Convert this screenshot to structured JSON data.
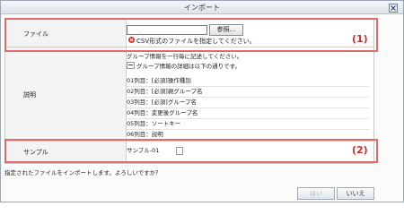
{
  "dialog": {
    "title": "インポート",
    "prompt": "指定されたファイルをインポートします。よろしいですか？",
    "yes_label": "はい",
    "no_label": "いいえ"
  },
  "form": {
    "file_label": "ファイル",
    "file_value": "",
    "browse_label": "参照...",
    "error_text": "CSV形式のファイルを指定してください。",
    "desc_label": "説明",
    "desc_line1": "グループ情報を一行毎に記述してください。",
    "desc_line2": "グループ情報の詳細は以下の通りです。",
    "columns": [
      "01列目：[必須]操作種別",
      "02列目：[必須]親グループ名",
      "03列目：[必須]グループ名",
      "04列目：変更後グループ名",
      "05列目：ソートキー",
      "06列目：説明"
    ],
    "sample_label": "サンプル",
    "sample_value": "サンプル-01"
  },
  "annotations": {
    "marker1": "(1)",
    "marker2": "(2)",
    "color": "#e06b6b"
  },
  "colors": {
    "error": "#d9362b",
    "marker_text": "#d12a2a"
  }
}
